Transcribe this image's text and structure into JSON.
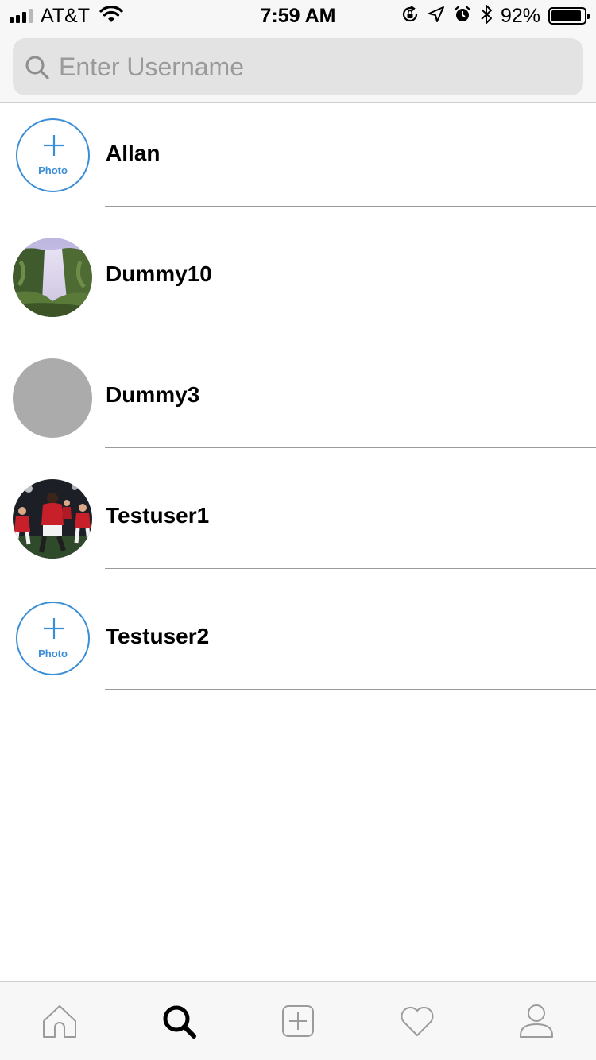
{
  "status_bar": {
    "carrier": "AT&T",
    "time": "7:59 AM",
    "battery_percent": "92%",
    "battery_level": 0.92,
    "icons": [
      "signal-icon",
      "wifi-icon",
      "orientation-lock-icon",
      "location-icon",
      "alarm-icon",
      "bluetooth-icon",
      "battery-icon"
    ]
  },
  "search": {
    "placeholder": "Enter Username",
    "value": "",
    "icon": "search-icon"
  },
  "users": [
    {
      "name": "Allan",
      "avatar": "add-photo",
      "avatar_label": "Photo"
    },
    {
      "name": "Dummy10",
      "avatar": "waterfall-photo"
    },
    {
      "name": "Dummy3",
      "avatar": "gray-placeholder"
    },
    {
      "name": "Testuser1",
      "avatar": "football-players-photo"
    },
    {
      "name": "Testuser2",
      "avatar": "add-photo",
      "avatar_label": "Photo"
    }
  ],
  "tab_bar": {
    "tabs": [
      {
        "icon": "home-icon",
        "active": false
      },
      {
        "icon": "search-icon",
        "active": true
      },
      {
        "icon": "add-post-icon",
        "active": false
      },
      {
        "icon": "heart-icon",
        "active": false
      },
      {
        "icon": "profile-icon",
        "active": false
      }
    ]
  },
  "colors": {
    "accent": "#3a8ed8",
    "header_bg": "#f7f7f7",
    "search_field_bg": "#e3e3e3",
    "placeholder_avatar": "#ababab",
    "separator": "#9a9a9a",
    "inactive_icon": "#9b9b9b"
  }
}
